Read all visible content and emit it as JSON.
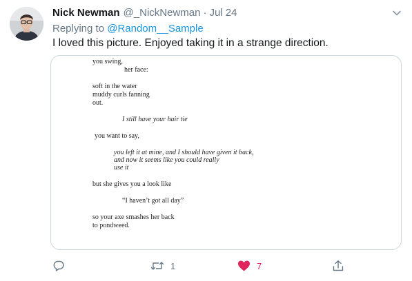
{
  "tweet": {
    "display_name": "Nick Newman",
    "handle": "@_NickNewman",
    "separator": "·",
    "date": "Jul 24",
    "replying_prefix": "Replying to",
    "replying_to": "@Random__Sample",
    "text": "I loved this picture. Enjoyed taking it in a strange direction."
  },
  "poem_lines": [
    "you swing,",
    "her face:",
    "soft in the water",
    "muddy curls fanning",
    "out.",
    "I still have your hair tie",
    "you want to say,",
    "you left it at mine, and I should have given it back,",
    "and now it seems like you could really",
    "use it",
    "but she gives you a look like",
    "“I haven’t got all day”",
    "so your axe smashes her back",
    "to pondweed."
  ],
  "actions": {
    "reply_icon": "reply-icon",
    "retweet_icon": "retweet-icon",
    "retweet_count": "1",
    "like_icon": "heart-icon",
    "like_count": "7",
    "share_icon": "share-icon"
  },
  "colors": {
    "accent": "#1b95e0",
    "muted": "#657786",
    "like": "#e0245e",
    "border": "#ccd6dd"
  }
}
